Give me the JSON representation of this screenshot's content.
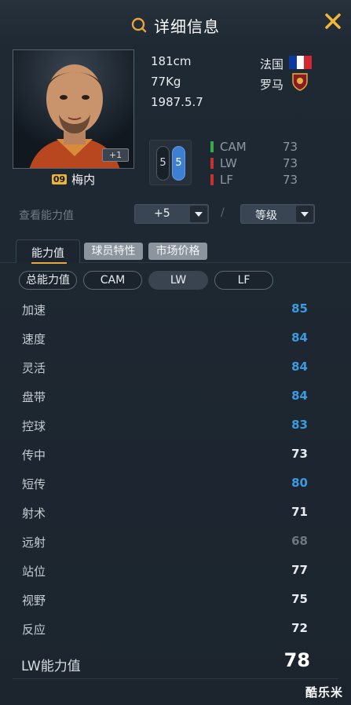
{
  "header": {
    "title": "详细信息",
    "title_icon": "search-icon",
    "close_icon": "close-icon"
  },
  "player": {
    "name": "梅内",
    "number": "09",
    "plus_badge": "+1",
    "height": "181cm",
    "weight": "77Kg",
    "birth": "1987.5.7",
    "nationality": "法国",
    "club": "罗马",
    "flag_colors": [
      "#0a3a9e",
      "#ffffff",
      "#d62631"
    ],
    "feet": {
      "left": "5",
      "right": "5"
    }
  },
  "positions": [
    {
      "name": "CAM",
      "value": "73",
      "color": "#3ba84a"
    },
    {
      "name": "LW",
      "value": "73",
      "color": "#c93030"
    },
    {
      "name": "LF",
      "value": "73",
      "color": "#c93030"
    }
  ],
  "view": {
    "label": "查看能力值",
    "plus_select": "+5",
    "separator": "/",
    "grade_select": "等级"
  },
  "tabs": [
    "能力值",
    "球员特性",
    "市场价格"
  ],
  "subtabs": [
    "总能力值",
    "CAM",
    "LW",
    "LF"
  ],
  "stats": [
    {
      "name": "加速",
      "value": "85",
      "color": "#3a9be0"
    },
    {
      "name": "速度",
      "value": "84",
      "color": "#3a9be0"
    },
    {
      "name": "灵活",
      "value": "84",
      "color": "#3a9be0"
    },
    {
      "name": "盘带",
      "value": "84",
      "color": "#3a9be0"
    },
    {
      "name": "控球",
      "value": "83",
      "color": "#3a9be0"
    },
    {
      "name": "传中",
      "value": "73",
      "color": "#e9edf1"
    },
    {
      "name": "短传",
      "value": "80",
      "color": "#3a9be0"
    },
    {
      "name": "射术",
      "value": "71",
      "color": "#e9edf1"
    },
    {
      "name": "远射",
      "value": "68",
      "color": "#6e7780"
    },
    {
      "name": "站位",
      "value": "77",
      "color": "#e9edf1"
    },
    {
      "name": "视野",
      "value": "75",
      "color": "#e9edf1"
    },
    {
      "name": "反应",
      "value": "72",
      "color": "#e9edf1"
    }
  ],
  "total": {
    "label": "LW能力值",
    "value": "78"
  },
  "watermark": "酷乐米"
}
